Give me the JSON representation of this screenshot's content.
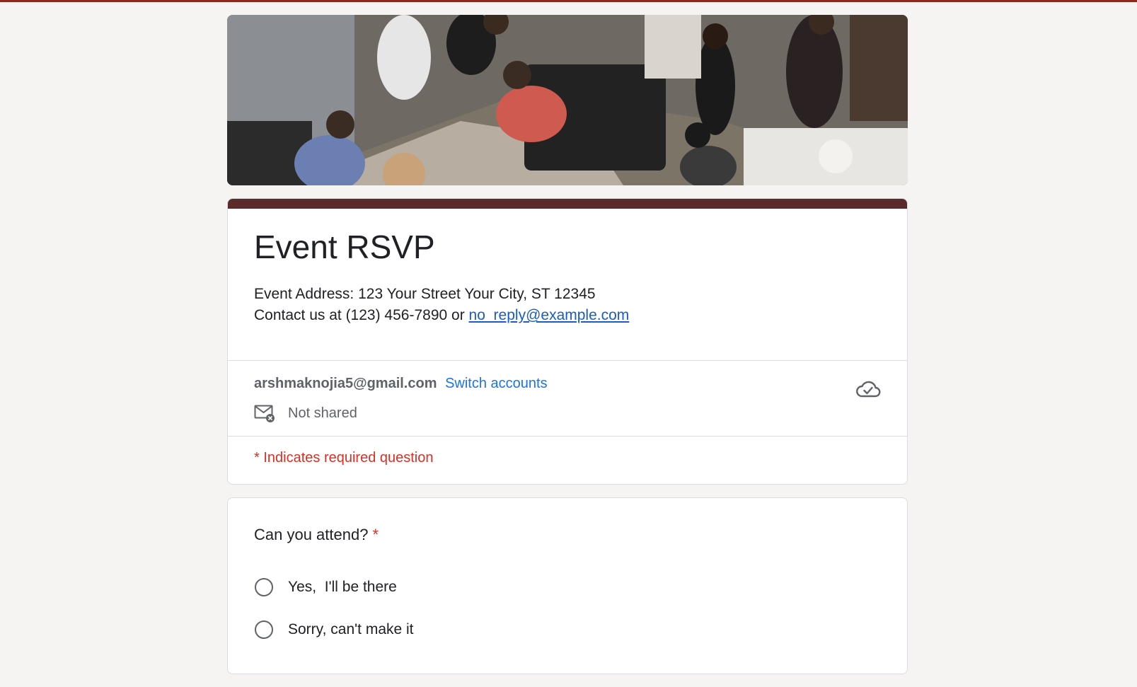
{
  "banner": {
    "alt": "people at a party"
  },
  "form": {
    "title": "Event RSVP",
    "address_line": "Event Address: 123 Your Street Your City, ST 12345",
    "contact_prefix": "Contact us at (123) 456-7890 or ",
    "contact_email": "no_reply@example.com"
  },
  "account": {
    "email": "arshmaknojia5@gmail.com",
    "switch_label": "Switch accounts",
    "not_shared": "Not shared"
  },
  "required_note": "* Indicates required question",
  "question": {
    "title": "Can you attend?",
    "required_mark": "*",
    "options": [
      {
        "label": "Yes,  I'll be there"
      },
      {
        "label": "Sorry, can't make it"
      }
    ]
  },
  "colors": {
    "accent": "#5b2b2b",
    "link": "#1a73e8",
    "required": "#d93025",
    "top_line": "#8a2a1c"
  },
  "icons": {
    "not_shared": "mail-off-icon",
    "cloud": "cloud-saved-icon"
  }
}
